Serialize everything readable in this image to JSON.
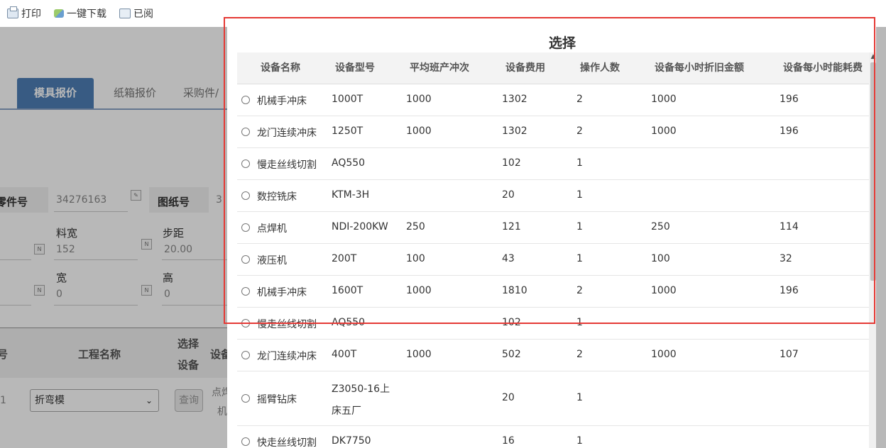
{
  "toolbar": {
    "print": "打印",
    "download": "一键下载",
    "read": "已阅"
  },
  "background": {
    "tabs": [
      "模具报价",
      "纸箱报价",
      "采购件/"
    ],
    "part_no_label": "零件号",
    "part_no_value": "34276163",
    "drawing_no_label": "图纸号",
    "drawing_no_value": "3",
    "material_width_label": "料宽",
    "material_width_value": "152",
    "step_label": "步距",
    "step_value": "20.00",
    "width_label": "宽",
    "width_value": "0",
    "height_label": "高",
    "height_value": "0",
    "col_no": "号",
    "col_process_name": "工程名称",
    "col_select_equipment_1": "选择",
    "col_select_equipment_2": "设备",
    "col_equipment": "设备",
    "row_index": "1",
    "process_select_value": "折弯模",
    "query_button": "查询",
    "equipment_cell_1": "点焊",
    "equipment_cell_2": "机"
  },
  "dialog": {
    "title": "选择",
    "columns": [
      "设备名称",
      "设备型号",
      "平均班产冲次",
      "设备费用",
      "操作人数",
      "设备每小时折旧金额",
      "设备每小时能耗费"
    ],
    "rows": [
      {
        "name": "机械手冲床",
        "model": "1000T",
        "model2": "",
        "shift_strokes": "1000",
        "cost": "1302",
        "operators": "2",
        "depreciation": "1000",
        "energy": "196"
      },
      {
        "name": "龙门连续冲床",
        "model": "1250T",
        "model2": "",
        "shift_strokes": "1000",
        "cost": "1302",
        "operators": "2",
        "depreciation": "1000",
        "energy": "196"
      },
      {
        "name": "慢走丝线切割",
        "model": "AQ550",
        "model2": "",
        "shift_strokes": "",
        "cost": "102",
        "operators": "1",
        "depreciation": "",
        "energy": ""
      },
      {
        "name": "数控铣床",
        "model": "KTM-3H",
        "model2": "",
        "shift_strokes": "",
        "cost": "20",
        "operators": "1",
        "depreciation": "",
        "energy": ""
      },
      {
        "name": "点焊机",
        "model": "NDI-200KW",
        "model2": "",
        "shift_strokes": "250",
        "cost": "121",
        "operators": "1",
        "depreciation": "250",
        "energy": "114"
      },
      {
        "name": "液压机",
        "model": "200T",
        "model2": "",
        "shift_strokes": "100",
        "cost": "43",
        "operators": "1",
        "depreciation": "100",
        "energy": "32"
      },
      {
        "name": "机械手冲床",
        "model": "1600T",
        "model2": "",
        "shift_strokes": "1000",
        "cost": "1810",
        "operators": "2",
        "depreciation": "1000",
        "energy": "196"
      },
      {
        "name": "慢走丝线切割",
        "model": "AQ550",
        "model2": "",
        "shift_strokes": "",
        "cost": "102",
        "operators": "1",
        "depreciation": "",
        "energy": ""
      },
      {
        "name": "龙门连续冲床",
        "model": "400T",
        "model2": "",
        "shift_strokes": "1000",
        "cost": "502",
        "operators": "2",
        "depreciation": "1000",
        "energy": "107"
      },
      {
        "name": "摇臂钻床",
        "model": "Z3050-16上",
        "model2": "床五厂",
        "shift_strokes": "",
        "cost": "20",
        "operators": "1",
        "depreciation": "",
        "energy": ""
      },
      {
        "name": "快走丝线切割",
        "model": "DK7750",
        "model2": "",
        "shift_strokes": "",
        "cost": "16",
        "operators": "1",
        "depreciation": "",
        "energy": ""
      }
    ]
  },
  "colors": {
    "active_tab": "#4e7fb6",
    "highlight_border": "#e53935",
    "header_bg": "#f3f3f3"
  }
}
